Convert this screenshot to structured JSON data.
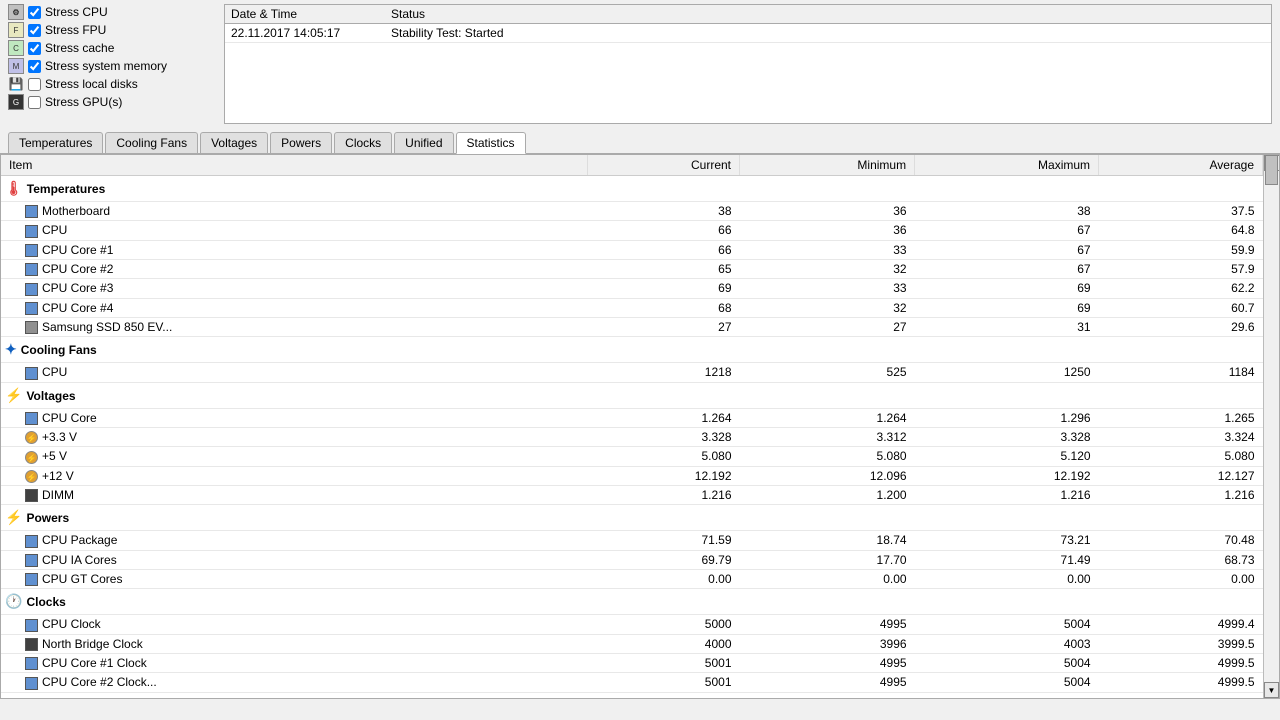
{
  "top": {
    "stress_options": [
      {
        "id": "stress-cpu",
        "label": "Stress CPU",
        "checked": true,
        "icon": "cpu"
      },
      {
        "id": "stress-fpu",
        "label": "Stress FPU",
        "checked": true,
        "icon": "fpu"
      },
      {
        "id": "stress-cache",
        "label": "Stress cache",
        "checked": true,
        "icon": "cache"
      },
      {
        "id": "stress-system-memory",
        "label": "Stress system memory",
        "checked": true,
        "icon": "mem"
      },
      {
        "id": "stress-local-disks",
        "label": "Stress local disks",
        "checked": false,
        "icon": "disk"
      },
      {
        "id": "stress-gpu",
        "label": "Stress GPU(s)",
        "checked": false,
        "icon": "gpu"
      }
    ],
    "log": {
      "columns": [
        "Date & Time",
        "Status"
      ],
      "rows": [
        {
          "date": "22.11.2017 14:05:17",
          "status": "Stability Test: Started"
        }
      ]
    }
  },
  "tabs": {
    "items": [
      {
        "id": "temperatures",
        "label": "Temperatures",
        "active": false
      },
      {
        "id": "cooling-fans",
        "label": "Cooling Fans",
        "active": false
      },
      {
        "id": "voltages",
        "label": "Voltages",
        "active": false
      },
      {
        "id": "powers",
        "label": "Powers",
        "active": false
      },
      {
        "id": "clocks",
        "label": "Clocks",
        "active": false
      },
      {
        "id": "unified",
        "label": "Unified",
        "active": false
      },
      {
        "id": "statistics",
        "label": "Statistics",
        "active": true
      }
    ]
  },
  "table": {
    "headers": [
      "Item",
      "Current",
      "Minimum",
      "Maximum",
      "Average"
    ],
    "groups": [
      {
        "name": "Temperatures",
        "icon": "temp",
        "rows": [
          {
            "name": "Motherboard",
            "current": "38",
            "minimum": "36",
            "maximum": "38",
            "average": "37.5",
            "icon": "blue"
          },
          {
            "name": "CPU",
            "current": "66",
            "minimum": "36",
            "maximum": "67",
            "average": "64.8",
            "icon": "blue"
          },
          {
            "name": "CPU Core #1",
            "current": "66",
            "minimum": "33",
            "maximum": "67",
            "average": "59.9",
            "icon": "blue"
          },
          {
            "name": "CPU Core #2",
            "current": "65",
            "minimum": "32",
            "maximum": "67",
            "average": "57.9",
            "icon": "blue"
          },
          {
            "name": "CPU Core #3",
            "current": "69",
            "minimum": "33",
            "maximum": "69",
            "average": "62.2",
            "icon": "blue"
          },
          {
            "name": "CPU Core #4",
            "current": "68",
            "minimum": "32",
            "maximum": "69",
            "average": "60.7",
            "icon": "blue"
          },
          {
            "name": "Samsung SSD 850 EV...",
            "current": "27",
            "minimum": "27",
            "maximum": "31",
            "average": "29.6",
            "icon": "gray"
          }
        ]
      },
      {
        "name": "Cooling Fans",
        "icon": "fan",
        "rows": [
          {
            "name": "CPU",
            "current": "1218",
            "minimum": "525",
            "maximum": "1250",
            "average": "1184",
            "icon": "blue"
          }
        ]
      },
      {
        "name": "Voltages",
        "icon": "volt",
        "rows": [
          {
            "name": "CPU Core",
            "current": "1.264",
            "minimum": "1.264",
            "maximum": "1.296",
            "average": "1.265",
            "icon": "blue"
          },
          {
            "name": "+3.3 V",
            "current": "3.328",
            "minimum": "3.312",
            "maximum": "3.328",
            "average": "3.324",
            "icon": "orange"
          },
          {
            "name": "+5 V",
            "current": "5.080",
            "minimum": "5.080",
            "maximum": "5.120",
            "average": "5.080",
            "icon": "orange"
          },
          {
            "name": "+12 V",
            "current": "12.192",
            "minimum": "12.096",
            "maximum": "12.192",
            "average": "12.127",
            "icon": "orange"
          },
          {
            "name": "DIMM",
            "current": "1.216",
            "minimum": "1.200",
            "maximum": "1.216",
            "average": "1.216",
            "icon": "dark"
          }
        ]
      },
      {
        "name": "Powers",
        "icon": "power",
        "rows": [
          {
            "name": "CPU Package",
            "current": "71.59",
            "minimum": "18.74",
            "maximum": "73.21",
            "average": "70.48",
            "icon": "blue"
          },
          {
            "name": "CPU IA Cores",
            "current": "69.79",
            "minimum": "17.70",
            "maximum": "71.49",
            "average": "68.73",
            "icon": "blue"
          },
          {
            "name": "CPU GT Cores",
            "current": "0.00",
            "minimum": "0.00",
            "maximum": "0.00",
            "average": "0.00",
            "icon": "blue"
          }
        ]
      },
      {
        "name": "Clocks",
        "icon": "clock",
        "rows": [
          {
            "name": "CPU Clock",
            "current": "5000",
            "minimum": "4995",
            "maximum": "5004",
            "average": "4999.4",
            "icon": "blue"
          },
          {
            "name": "North Bridge Clock",
            "current": "4000",
            "minimum": "3996",
            "maximum": "4003",
            "average": "3999.5",
            "icon": "dark"
          },
          {
            "name": "CPU Core #1 Clock",
            "current": "5001",
            "minimum": "4995",
            "maximum": "5004",
            "average": "4999.5",
            "icon": "blue"
          },
          {
            "name": "CPU Core #2 Clock...",
            "current": "5001",
            "minimum": "4995",
            "maximum": "5004",
            "average": "4999.5",
            "icon": "blue"
          }
        ]
      }
    ]
  }
}
